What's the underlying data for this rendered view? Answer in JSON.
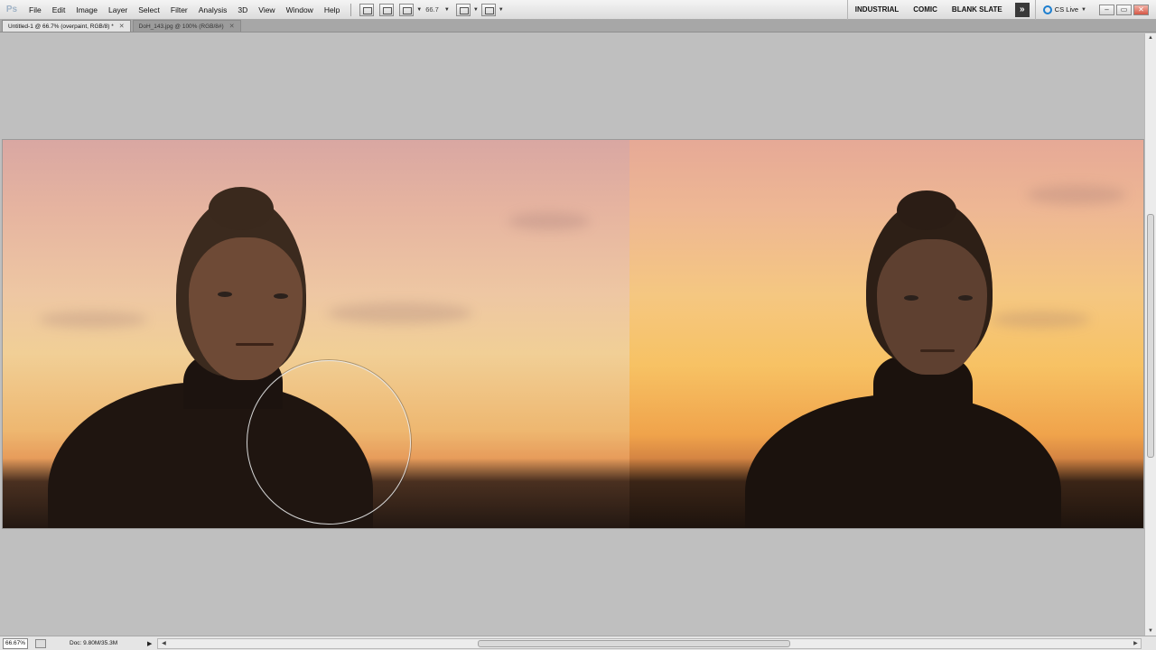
{
  "app": {
    "logo": "Ps",
    "menu": [
      "File",
      "Edit",
      "Image",
      "Layer",
      "Select",
      "Filter",
      "Analysis",
      "3D",
      "View",
      "Window",
      "Help"
    ],
    "zoom": "66.7",
    "workspaces": [
      "INDUSTRIAL",
      "COMIC",
      "BLANK SLATE"
    ],
    "more": "»",
    "cs_live": "CS Live",
    "window_buttons": {
      "minimize": "–",
      "restore": "▭",
      "close": "✕"
    }
  },
  "tabs": [
    {
      "label": "Untitled-1 @ 66.7% (overpaint, RGB/8) *",
      "active": true
    },
    {
      "label": "DoH_143.jpg @ 100% (RGB/8#)",
      "active": false
    }
  ],
  "status": {
    "zoom": "66.67%",
    "doc": "Doc: 9.80M/35.3M"
  },
  "colors": {
    "menubar": "#e4e4e4",
    "canvas_bg": "#bfbfbf",
    "sky_top": "#d9a7a2",
    "sky_horizon": "#f1cf96",
    "accent": "#1c7ecf"
  },
  "icons": {
    "dropdown": "chevron-down-icon",
    "cs_live": "cs-live-icon",
    "more": "double-chevron-icon"
  }
}
